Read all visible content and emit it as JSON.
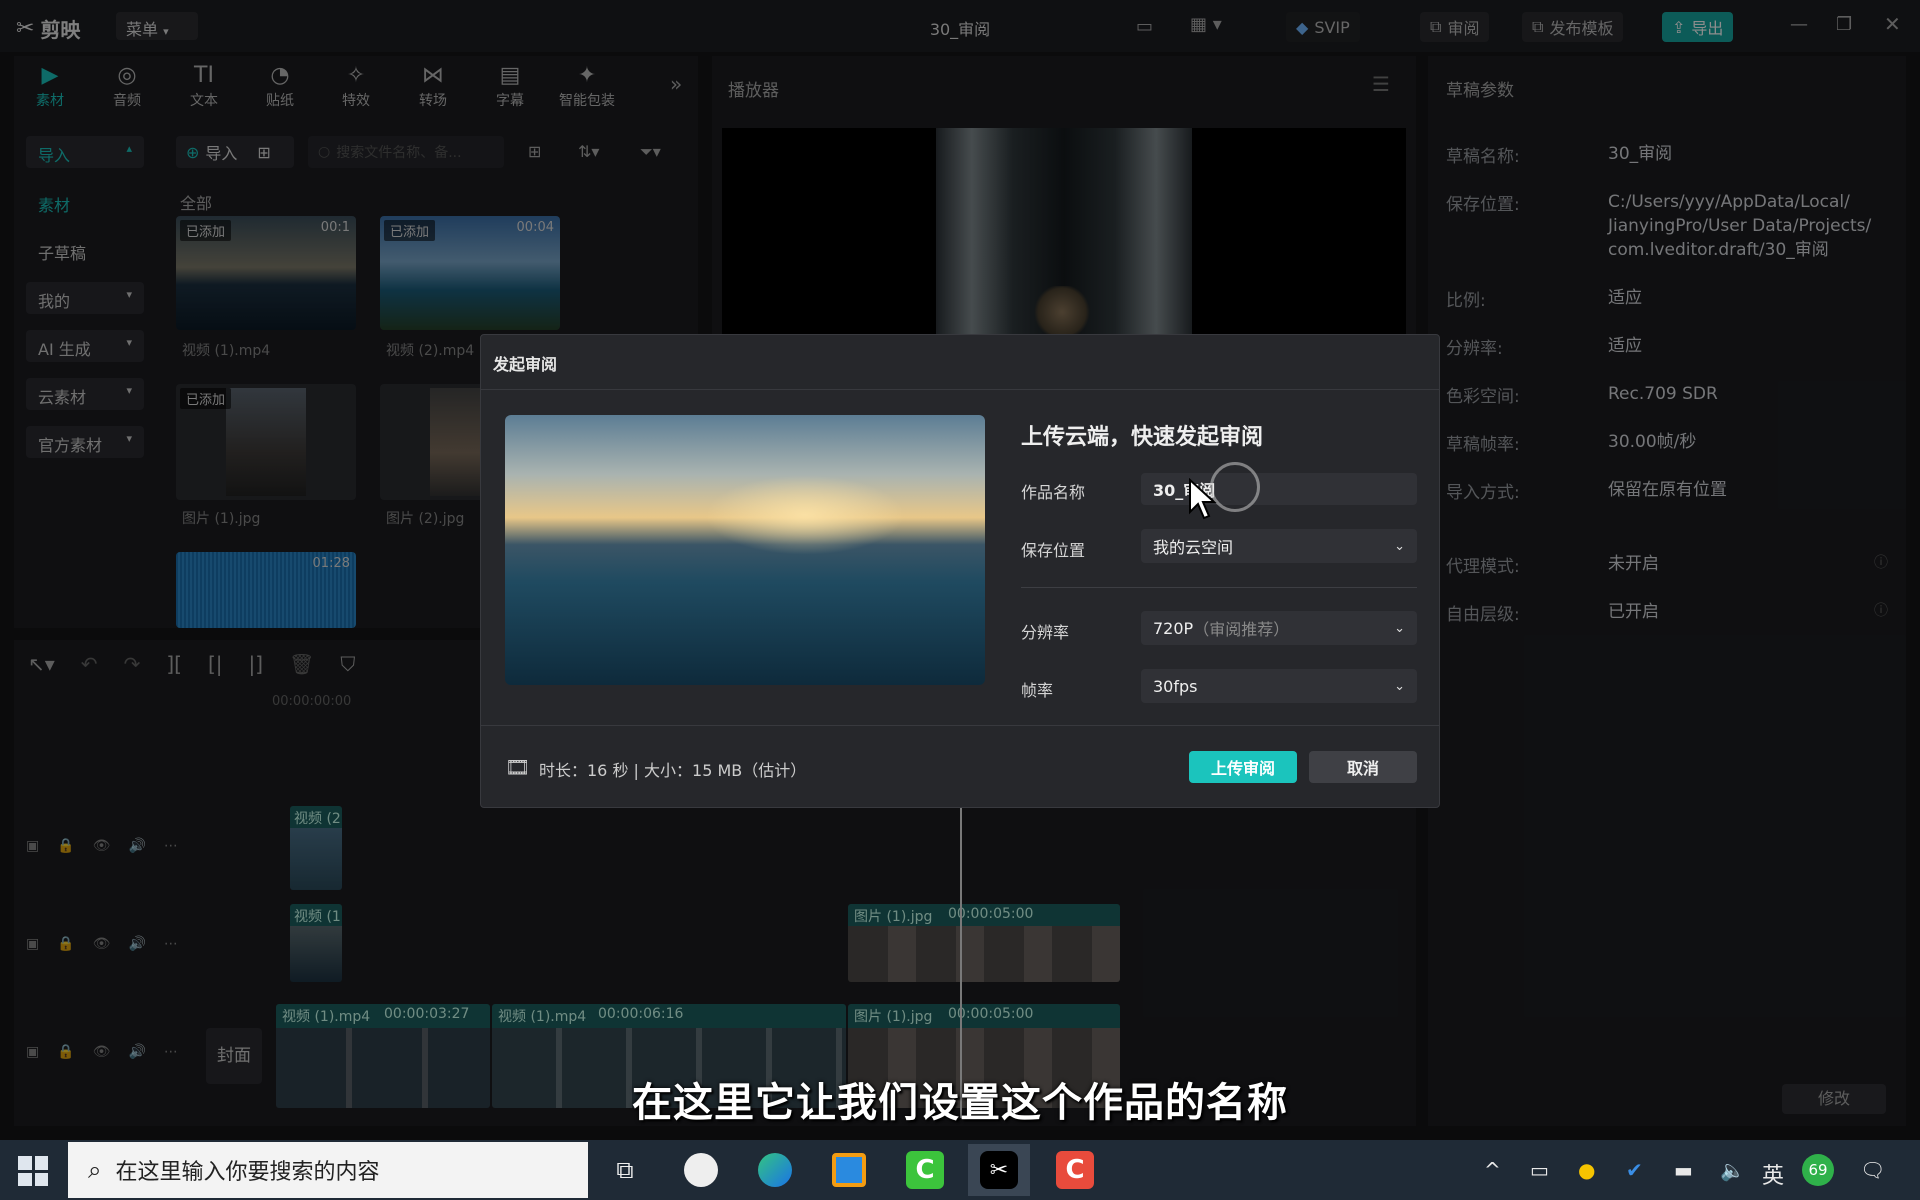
{
  "app": {
    "logo": "剪映",
    "menu_label": "菜单",
    "title": "30_审阅",
    "svip": "SVIP",
    "review_btn": "审阅",
    "publish_btn": "发布模板",
    "export_btn": "导出"
  },
  "toolbar": {
    "tabs": [
      {
        "label": "素材",
        "icon": "▶"
      },
      {
        "label": "音频",
        "icon": "◎"
      },
      {
        "label": "文本",
        "icon": "TI"
      },
      {
        "label": "贴纸",
        "icon": "◔"
      },
      {
        "label": "特效",
        "icon": "✧"
      },
      {
        "label": "转场",
        "icon": "⋈"
      },
      {
        "label": "字幕",
        "icon": "▤"
      },
      {
        "label": "智能包装",
        "icon": "✦"
      }
    ]
  },
  "sidebar": {
    "items": [
      "导入",
      "素材",
      "子草稿",
      "我的",
      "AI 生成",
      "云素材",
      "官方素材"
    ]
  },
  "media": {
    "import_label": "导入",
    "search_placeholder": "搜索文件名称、备...",
    "all_label": "全部",
    "added_tag": "已添加",
    "items": [
      {
        "name": "视频 (1).mp4",
        "duration": "00:1"
      },
      {
        "name": "视频 (2).mp4",
        "duration": "00:04"
      },
      {
        "name": "图片 (1).jpg",
        "duration": ""
      },
      {
        "name": "图片 (2).jpg",
        "duration": ""
      }
    ],
    "audio_duration": "01:28"
  },
  "player": {
    "title": "播放器"
  },
  "params": {
    "title": "草稿参数",
    "rows": [
      {
        "k": "草稿名称:",
        "v": "30_审阅"
      },
      {
        "k": "保存位置:",
        "v": "C:/Users/yyy/AppData/Local/\nJianyingPro/User Data/Projects/\ncom.lveditor.draft/30_审阅"
      },
      {
        "k": "比例:",
        "v": "适应"
      },
      {
        "k": "分辨率:",
        "v": "适应"
      },
      {
        "k": "色彩空间:",
        "v": "Rec.709 SDR"
      },
      {
        "k": "草稿帧率:",
        "v": "30.00帧/秒"
      },
      {
        "k": "导入方式:",
        "v": "保留在原有位置"
      },
      {
        "k": "代理模式:",
        "v": "未开启"
      },
      {
        "k": "自由层级:",
        "v": "已开启"
      }
    ],
    "modify_btn": "修改"
  },
  "timeline": {
    "ruler_start": "00:00:00:00",
    "cover_label": "封面",
    "clips": {
      "t1a": "视频 (2",
      "t2a": "视频 (1",
      "t2b_name": "图片 (1).jpg",
      "t2b_dur": "00:00:05:00",
      "m1_name": "视频 (1).mp4",
      "m1_dur": "00:00:03:27",
      "m2_name": "视频 (1).mp4",
      "m2_dur": "00:00:06:16",
      "m3_name": "图片 (1).jpg",
      "m3_dur": "00:00:05:00"
    }
  },
  "dialog": {
    "title": "发起审阅",
    "heading": "上传云端，快速发起审阅",
    "name_label": "作品名称",
    "name_value": "30_审阅",
    "location_label": "保存位置",
    "location_value": "我的云空间",
    "resolution_label": "分辨率",
    "resolution_value": "720P",
    "resolution_hint": "（审阅推荐）",
    "fps_label": "帧率",
    "fps_value": "30fps",
    "info": "时长：16 秒 | 大小：15 MB（估计）",
    "upload_btn": "上传审阅",
    "cancel_btn": "取消"
  },
  "subtitle": "在这里它让我们设置这个作品的名称",
  "taskbar": {
    "search_placeholder": "在这里输入你要搜索的内容",
    "ime": "英",
    "badge": "69"
  }
}
